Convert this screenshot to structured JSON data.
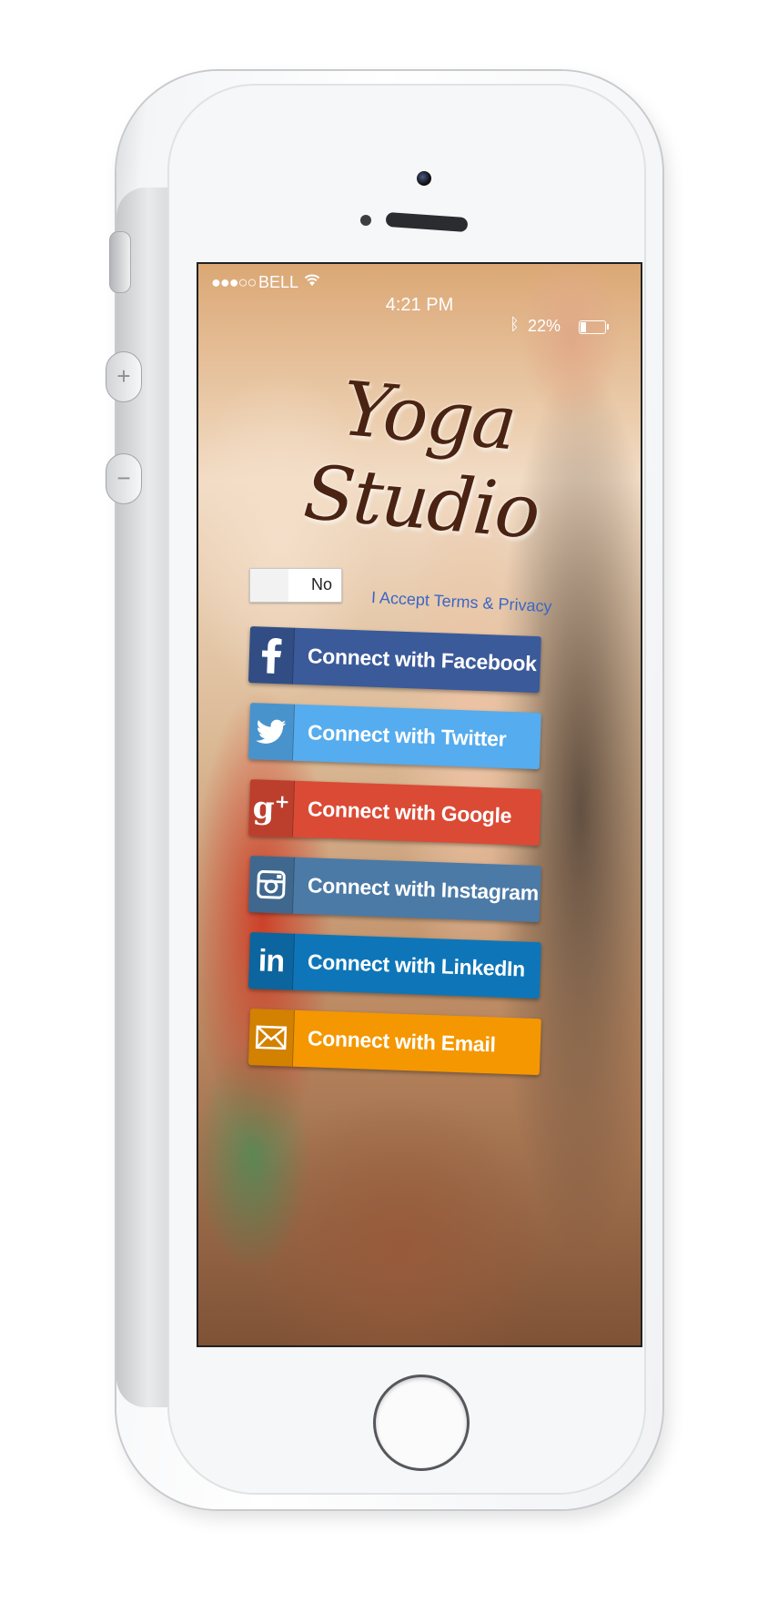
{
  "status_bar": {
    "signal": "●●●○○",
    "carrier": "BELL",
    "time": "4:21 PM",
    "battery": "22%",
    "battery_level": 0.22
  },
  "app": {
    "title": "Yoga Studio"
  },
  "terms": {
    "toggle_value": "No",
    "label": "I Accept Terms & Privacy"
  },
  "connect_buttons": [
    {
      "label": "Connect with Facebook",
      "icon": "facebook-icon",
      "color": "#3b5a9a"
    },
    {
      "label": "Connect with Twitter",
      "icon": "twitter-icon",
      "color": "#55acee"
    },
    {
      "label": "Connect with Google",
      "icon": "google-plus-icon",
      "color": "#db4a35"
    },
    {
      "label": "Connect with Instagram",
      "icon": "instagram-icon",
      "color": "#4b7aa6"
    },
    {
      "label": "Connect with LinkedIn",
      "icon": "linkedin-icon",
      "color": "#0e76b8"
    },
    {
      "label": "Connect with Email",
      "icon": "email-icon",
      "color": "#f59700"
    }
  ]
}
